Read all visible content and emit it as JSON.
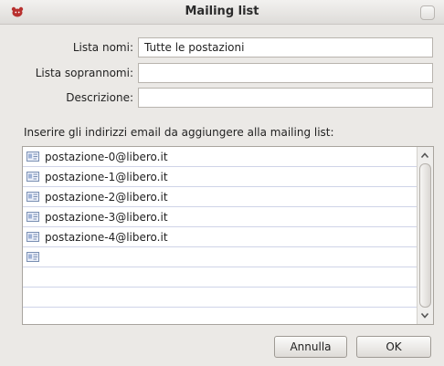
{
  "window": {
    "title": "Mailing list"
  },
  "form": {
    "list_name_label": "Lista nomi:",
    "list_name_value": "Tutte le postazioni",
    "nicknames_label": "Lista soprannomi:",
    "nicknames_value": "",
    "description_label": "Descrizione:",
    "description_value": ""
  },
  "instructions": "Inserire gli indirizzi email da aggiungere alla mailing list:",
  "addresses": [
    "postazione-0@libero.it",
    "postazione-1@libero.it",
    "postazione-2@libero.it",
    "postazione-3@libero.it",
    "postazione-4@libero.it",
    ""
  ],
  "buttons": {
    "cancel": "Annulla",
    "ok": "OK"
  },
  "icons": {
    "app": "red-mascot-icon",
    "close": "close-icon",
    "contact": "address-card-icon",
    "scroll_up": "chevron-up-icon",
    "scroll_down": "chevron-down-icon"
  },
  "colors": {
    "window_bg": "#ebe9e6",
    "row_divider": "#cfd4e8"
  }
}
